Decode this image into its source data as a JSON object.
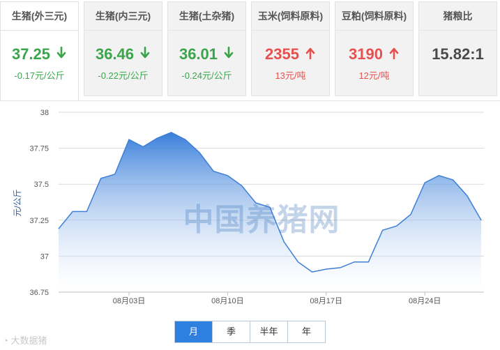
{
  "tiles": [
    {
      "name": "生猪(外三元)",
      "value": "37.25",
      "change": "-0.17元/公斤",
      "trend": "down"
    },
    {
      "name": "生猪(内三元)",
      "value": "36.46",
      "change": "-0.22元/公斤",
      "trend": "down"
    },
    {
      "name": "生猪(土杂猪)",
      "value": "36.01",
      "change": "-0.24元/公斤",
      "trend": "down"
    },
    {
      "name": "玉米(饲料原料)",
      "value": "2355",
      "change": "13元/吨",
      "trend": "up"
    },
    {
      "name": "豆粕(饲料原料)",
      "value": "3190",
      "change": "12元/吨",
      "trend": "up"
    },
    {
      "name": "猪粮比",
      "value": "15.82:1",
      "change": "",
      "trend": "none"
    }
  ],
  "colors": {
    "down": "#3aa54a",
    "up": "#e8504f",
    "line": "#3d7fd6",
    "accent": "#2f7fde"
  },
  "chart_data": {
    "type": "area",
    "ylabel": "元/公斤",
    "ylim": [
      36.75,
      38
    ],
    "yticks": [
      "36.75",
      "37",
      "37.25",
      "37.5",
      "37.75",
      "38"
    ],
    "xticks": [
      {
        "label": "08月03日",
        "index": 5
      },
      {
        "label": "08月10日",
        "index": 12
      },
      {
        "label": "08月17日",
        "index": 19
      },
      {
        "label": "08月24日",
        "index": 26
      }
    ],
    "values": [
      37.19,
      37.31,
      37.31,
      37.54,
      37.57,
      37.81,
      37.76,
      37.82,
      37.86,
      37.81,
      37.72,
      37.59,
      37.56,
      37.49,
      37.37,
      37.34,
      37.1,
      36.96,
      36.89,
      36.91,
      36.92,
      36.96,
      36.96,
      37.18,
      37.21,
      37.29,
      37.51,
      37.56,
      37.53,
      37.42,
      37.25
    ],
    "grid": true
  },
  "watermark": "中国养猪网",
  "periods": [
    "月",
    "季",
    "半年",
    "年"
  ],
  "active_period": 0,
  "corner_logo": "大数据猪"
}
